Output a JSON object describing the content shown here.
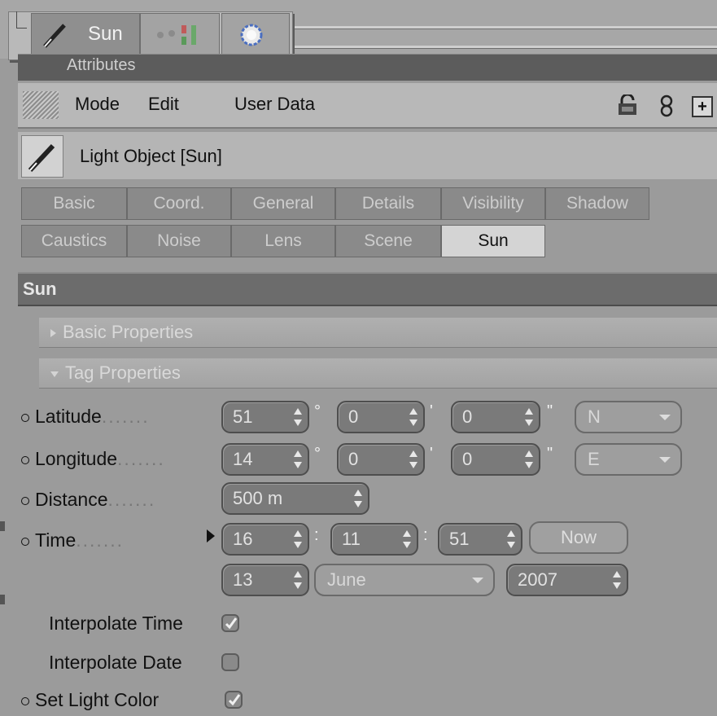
{
  "object_manager": {
    "object_name": "Sun"
  },
  "attributes": {
    "panel_title": "Attributes",
    "menu": [
      "Mode",
      "Edit",
      "User Data"
    ]
  },
  "object_header": {
    "title": "Light Object [Sun]"
  },
  "tabs": {
    "row1": [
      "Basic",
      "Coord.",
      "General",
      "Details",
      "Visibility",
      "Shadow"
    ],
    "row2": [
      "Caustics",
      "Noise",
      "Lens",
      "Scene",
      "Sun"
    ],
    "active": "Sun"
  },
  "section": {
    "title": "Sun",
    "groups": {
      "basic": "Basic Properties",
      "tag": "Tag Properties"
    }
  },
  "params": {
    "latitude": {
      "label": "Latitude",
      "deg": "51",
      "min": "0",
      "sec": "0",
      "hemisphere": "N"
    },
    "longitude": {
      "label": "Longitude",
      "deg": "14",
      "min": "0",
      "sec": "0",
      "hemisphere": "E"
    },
    "distance": {
      "label": "Distance",
      "value": "500 m"
    },
    "time": {
      "label": "Time",
      "hour": "16",
      "minute": "11",
      "second": "51",
      "now_label": "Now"
    },
    "date": {
      "day": "13",
      "month": "June",
      "year": "2007"
    },
    "interpolate_time": {
      "label": "Interpolate Time",
      "checked": true
    },
    "interpolate_date": {
      "label": "Interpolate Date",
      "checked": false
    },
    "set_light_color": {
      "label": "Set Light Color",
      "checked": true
    }
  },
  "units": {
    "degree": "°",
    "minute": "'",
    "second": "\"",
    "time_sep": ":"
  },
  "dots": ".......",
  "colors": {
    "panel": "#9b9b9b",
    "field": "#7a7a7a",
    "section": "#6c6c6c",
    "active_tab": "#d4d4d4"
  }
}
